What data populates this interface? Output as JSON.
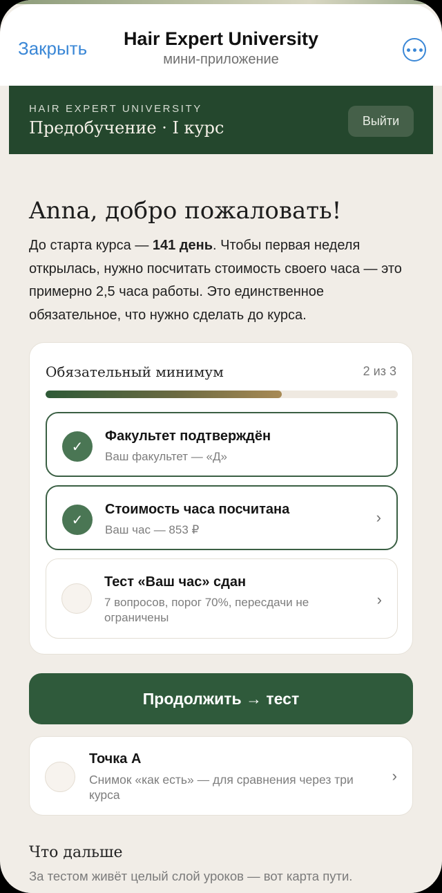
{
  "miniapp": {
    "close_label": "Закрыть",
    "title": "Hair Expert University",
    "subtitle": "мини-приложение",
    "more_icon": "ellipsis-circle-icon"
  },
  "banner": {
    "kicker": "HAIR EXPERT UNIVERSITY",
    "title": "Предобучение · I курс",
    "logout_label": "Выйти"
  },
  "welcome": {
    "heading": "Anna, добро пожаловать!",
    "intro_prefix": "До старта курса — ",
    "intro_days": "141 день",
    "intro_rest": ". Чтобы первая неделя открылась, нужно посчитать стоимость своего часа — это примерно 2,5 часа работы. Это единственное обязательное, что нужно сделать до курса."
  },
  "requirements": {
    "title": "Обязательный минимум",
    "count": "2 из 3",
    "progress_percent": 67,
    "tasks": [
      {
        "title": "Факультет подтверждён",
        "subtitle": "Ваш факультет — «Д»",
        "done": true
      },
      {
        "title": "Стоимость часа посчитана",
        "subtitle": "Ваш час — 853 ₽",
        "done": true
      },
      {
        "title": "Тест «Ваш час» сдан",
        "subtitle": "7 вопросов, порог 70%, пересдачи не ограничены",
        "done": false
      }
    ]
  },
  "continue_label": "Продолжить → тест",
  "point_a": {
    "title": "Точка А",
    "subtitle": "Снимок «как есть» — для сравнения через три курса"
  },
  "next": {
    "title": "Что дальше",
    "subtitle": "За тестом живёт целый слой уроков — вот карта пути."
  },
  "colors": {
    "accent_blue": "#3a87d6",
    "brand_green": "#24472d",
    "button_green": "#2f5a3b",
    "background": "#f1ede7"
  }
}
